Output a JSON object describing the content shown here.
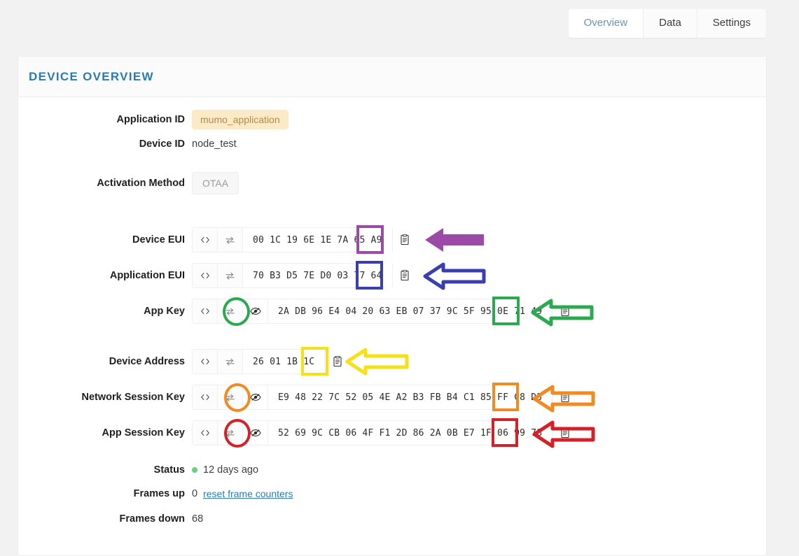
{
  "tabs": [
    {
      "label": "Overview",
      "active": true
    },
    {
      "label": "Data",
      "active": false
    },
    {
      "label": "Settings",
      "active": false
    }
  ],
  "card": {
    "title": "DEVICE OVERVIEW"
  },
  "fields": {
    "application_id": {
      "label": "Application ID",
      "value": "mumo_application"
    },
    "device_id": {
      "label": "Device ID",
      "value": "node_test"
    },
    "activation_method": {
      "label": "Activation Method",
      "value": "OTAA"
    },
    "device_eui": {
      "label": "Device EUI",
      "value": "00 1C 19 6E 1E 7A 65 A9"
    },
    "application_eui": {
      "label": "Application EUI",
      "value": "70 B3 D5 7E D0 03 77 64"
    },
    "app_key": {
      "label": "App Key",
      "value": "2A DB 96 E4 04 20 63 EB 07 37 9C 5F 95 0E 71 49"
    },
    "device_address": {
      "label": "Device Address",
      "value": "26 01 1B 1C"
    },
    "network_session_key": {
      "label": "Network Session Key",
      "value": "E9 48 22 7C 52 05 4E A2 B3 FB B4 C1 85 FF C8 D3"
    },
    "app_session_key": {
      "label": "App Session Key",
      "value": "52 69 9C CB 06 4F F1 2D 86 2A 0B E7 1F 06 99 78"
    },
    "status": {
      "label": "Status",
      "value": "12 days ago"
    },
    "frames_up": {
      "label": "Frames up",
      "value": "0",
      "reset_link": "reset frame counters"
    },
    "frames_down": {
      "label": "Frames down",
      "value": "68"
    }
  },
  "annotations": {
    "device_eui": {
      "color": "#9b4aa8"
    },
    "application_eui": {
      "color": "#3a3fb0"
    },
    "app_key": {
      "color": "#2aa94f"
    },
    "device_address": {
      "color": "#f5e114"
    },
    "network_session_key": {
      "color": "#f28a22"
    },
    "app_session_key": {
      "color": "#d62027"
    }
  },
  "colors": {
    "accent": "#2a7cb0",
    "badge_bg": "#fce9c6",
    "badge_text": "#b08a4a",
    "status_dot": "#62d47e",
    "page_bg": "#f2f2f2"
  },
  "icons": {
    "code": "code-brackets-icon",
    "swap": "swap-arrows-icon",
    "eye": "eye-slash-icon",
    "copy": "clipboard-copy-icon"
  }
}
